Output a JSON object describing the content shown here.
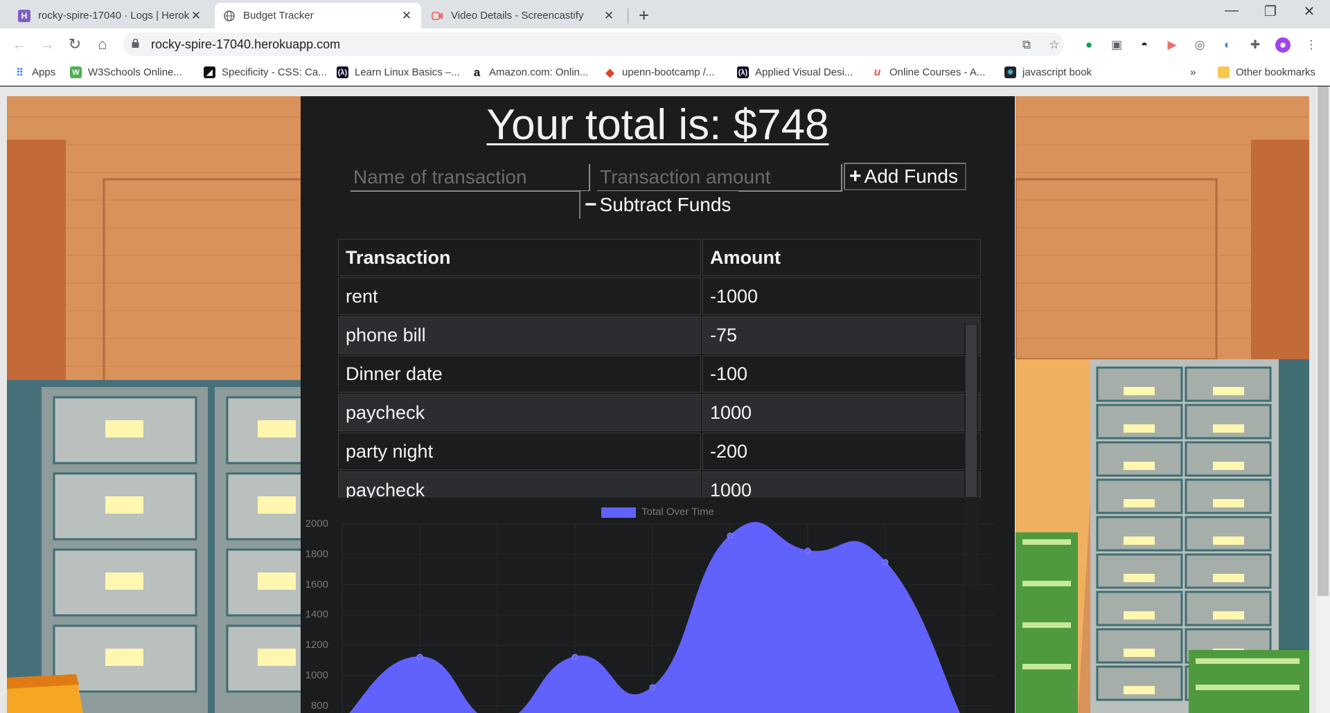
{
  "browser": {
    "tabs": [
      {
        "title": "rocky-spire-17040 · Logs | Heroku",
        "favicon": "heroku-icon",
        "active": false
      },
      {
        "title": "Budget Tracker",
        "favicon": "globe-icon",
        "active": true
      },
      {
        "title": "Video Details - Screencastify",
        "favicon": "screencastify-icon",
        "active": false
      }
    ],
    "url": "rocky-spire-17040.herokuapp.com",
    "bookmarks": [
      {
        "label": "Apps",
        "icon": "apps-grid-icon"
      },
      {
        "label": "W3Schools Online...",
        "icon": "w3schools-icon"
      },
      {
        "label": "Specificity - CSS: Ca...",
        "icon": "mdn-icon"
      },
      {
        "label": "Learn Linux Basics –...",
        "icon": "freecodecamp-icon"
      },
      {
        "label": "Amazon.com: Onlin...",
        "icon": "amazon-icon"
      },
      {
        "label": "upenn-bootcamp /...",
        "icon": "gitlab-icon"
      },
      {
        "label": "Applied Visual Desi...",
        "icon": "freecodecamp-icon"
      },
      {
        "label": "Online Courses - A...",
        "icon": "udemy-icon"
      },
      {
        "label": "javascript book",
        "icon": "react-icon"
      }
    ],
    "overflow_label": "»",
    "other_bookmarks": "Other bookmarks"
  },
  "app": {
    "total_text": "Your total is: $748",
    "name_placeholder": "Name of transaction",
    "amount_placeholder": "Transaction amount",
    "add_label": "Add Funds",
    "subtract_label": "Subtract Funds",
    "table": {
      "headers": [
        "Transaction",
        "Amount"
      ],
      "rows": [
        [
          "rent",
          "-1000"
        ],
        [
          "phone bill",
          "-75"
        ],
        [
          "Dinner date",
          "-100"
        ],
        [
          "paycheck",
          "1000"
        ],
        [
          "party night",
          "-200"
        ],
        [
          "paycheck",
          "1000"
        ]
      ]
    }
  },
  "chart_data": {
    "type": "area",
    "series": [
      {
        "name": "Total Over Time",
        "color": "#6161fb"
      }
    ],
    "yticks": [
      "2000",
      "1800",
      "1600",
      "1400",
      "1200",
      "1000",
      "800"
    ],
    "ylim": [
      800,
      2000
    ],
    "points": [
      {
        "x": 0,
        "y": 700
      },
      {
        "x": 1,
        "y": 1123
      },
      {
        "x": 2,
        "y": 700
      },
      {
        "x": 3,
        "y": 1123
      },
      {
        "x": 4,
        "y": 923
      },
      {
        "x": 5,
        "y": 1923
      },
      {
        "x": 6,
        "y": 1823
      },
      {
        "x": 7,
        "y": 1748
      },
      {
        "x": 8,
        "y": 700
      }
    ]
  }
}
